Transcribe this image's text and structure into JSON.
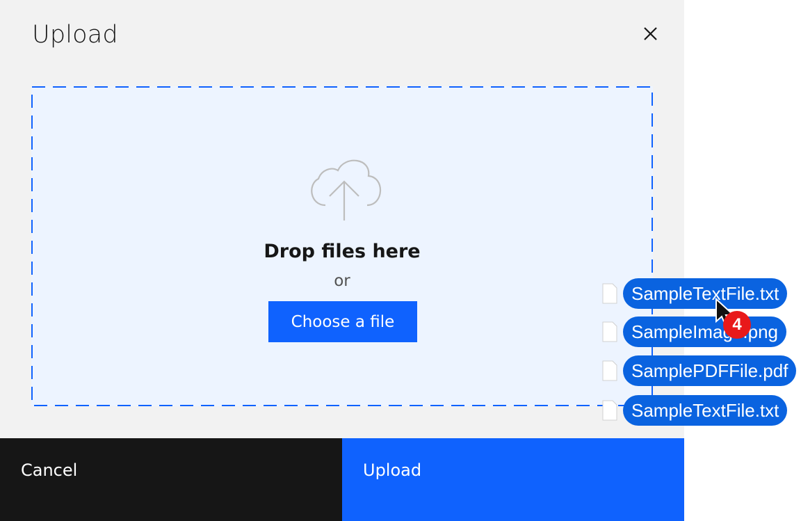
{
  "dialog": {
    "title": "Upload",
    "close_icon": "close-icon"
  },
  "dropzone": {
    "icon": "cloud-upload-icon",
    "heading": "Drop files here",
    "or_text": "or",
    "choose_button": "Choose a file"
  },
  "footer": {
    "cancel_label": "Cancel",
    "upload_label": "Upload"
  },
  "drag_preview": {
    "files": [
      {
        "name": "SampleTextFile.txt",
        "icon": "document-icon"
      },
      {
        "name": "SampleImage.png",
        "icon": "document-icon"
      },
      {
        "name": "SamplePDFFile.pdf",
        "icon": "document-icon"
      },
      {
        "name": "SampleTextFile.txt",
        "icon": "document-icon"
      }
    ],
    "count_badge": "4"
  },
  "colors": {
    "primary": "#0f62fe",
    "dropzone_bg": "#edf4ff",
    "modal_bg": "#f2f2f2",
    "dark": "#161616",
    "badge": "#e8191a"
  }
}
